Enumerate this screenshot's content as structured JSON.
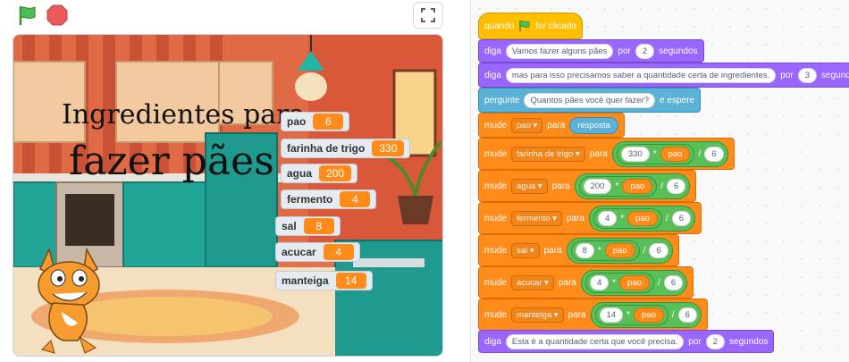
{
  "stage": {
    "title_line1": "Ingredientes para",
    "title_line2": "fazer pães",
    "monitors": [
      {
        "name": "pao",
        "value": "6"
      },
      {
        "name": "farinha de trigo",
        "value": "330"
      },
      {
        "name": "agua",
        "value": "200"
      },
      {
        "name": "fermento",
        "value": "4"
      },
      {
        "name": "sal",
        "value": "8"
      },
      {
        "name": "acucar",
        "value": "4"
      },
      {
        "name": "manteiga",
        "value": "14"
      }
    ]
  },
  "icons": {
    "flag": "green-flag-icon",
    "stop": "stop-icon",
    "fullscreen": "fullscreen-icon"
  },
  "script": {
    "hat": {
      "when": "quando",
      "clicked": "for clicado"
    },
    "say1": {
      "cmd": "diga",
      "text": "Vamos fazer alguns pães",
      "por": "por",
      "secs": "2",
      "unit": "segundos"
    },
    "say2": {
      "cmd": "diga",
      "text": "mas para isso precisamos saber a quantidade certa de ingredientes.",
      "por": "por",
      "secs": "3",
      "unit": "segundos"
    },
    "ask": {
      "cmd": "pergunte",
      "text": "Quantos pães você quer fazer?",
      "wait": "e espere"
    },
    "set_pao": {
      "cmd": "mude",
      "var": "pao",
      "para": "para",
      "reporter": "resposta"
    },
    "set_ops": [
      {
        "cmd": "mude",
        "var": "farinha de trigo",
        "para": "para",
        "a": "330",
        "mul": "*",
        "b": "pao",
        "div": "/",
        "c": "6"
      },
      {
        "cmd": "mude",
        "var": "agua",
        "para": "para",
        "a": "200",
        "mul": "*",
        "b": "pao",
        "div": "/",
        "c": "6"
      },
      {
        "cmd": "mude",
        "var": "fermento",
        "para": "para",
        "a": "4",
        "mul": "*",
        "b": "pao",
        "div": "/",
        "c": "6"
      },
      {
        "cmd": "mude",
        "var": "sal",
        "para": "para",
        "a": "8",
        "mul": "*",
        "b": "pao",
        "div": "/",
        "c": "6"
      },
      {
        "cmd": "mude",
        "var": "acucar",
        "para": "para",
        "a": "4",
        "mul": "*",
        "b": "pao",
        "div": "/",
        "c": "6"
      },
      {
        "cmd": "mude",
        "var": "manteiga",
        "para": "para",
        "a": "14",
        "mul": "*",
        "b": "pao",
        "div": "/",
        "c": "6"
      }
    ],
    "say3": {
      "cmd": "diga",
      "text": "Esta é a quantidade certa que você precisa.",
      "por": "por",
      "secs": "2",
      "unit": "segundos"
    }
  },
  "colors": {
    "looks": "#9966ff",
    "sensing": "#5cb1d6",
    "variables": "#ff8c1a",
    "operators": "#59c059",
    "events": "#ffbf00"
  }
}
